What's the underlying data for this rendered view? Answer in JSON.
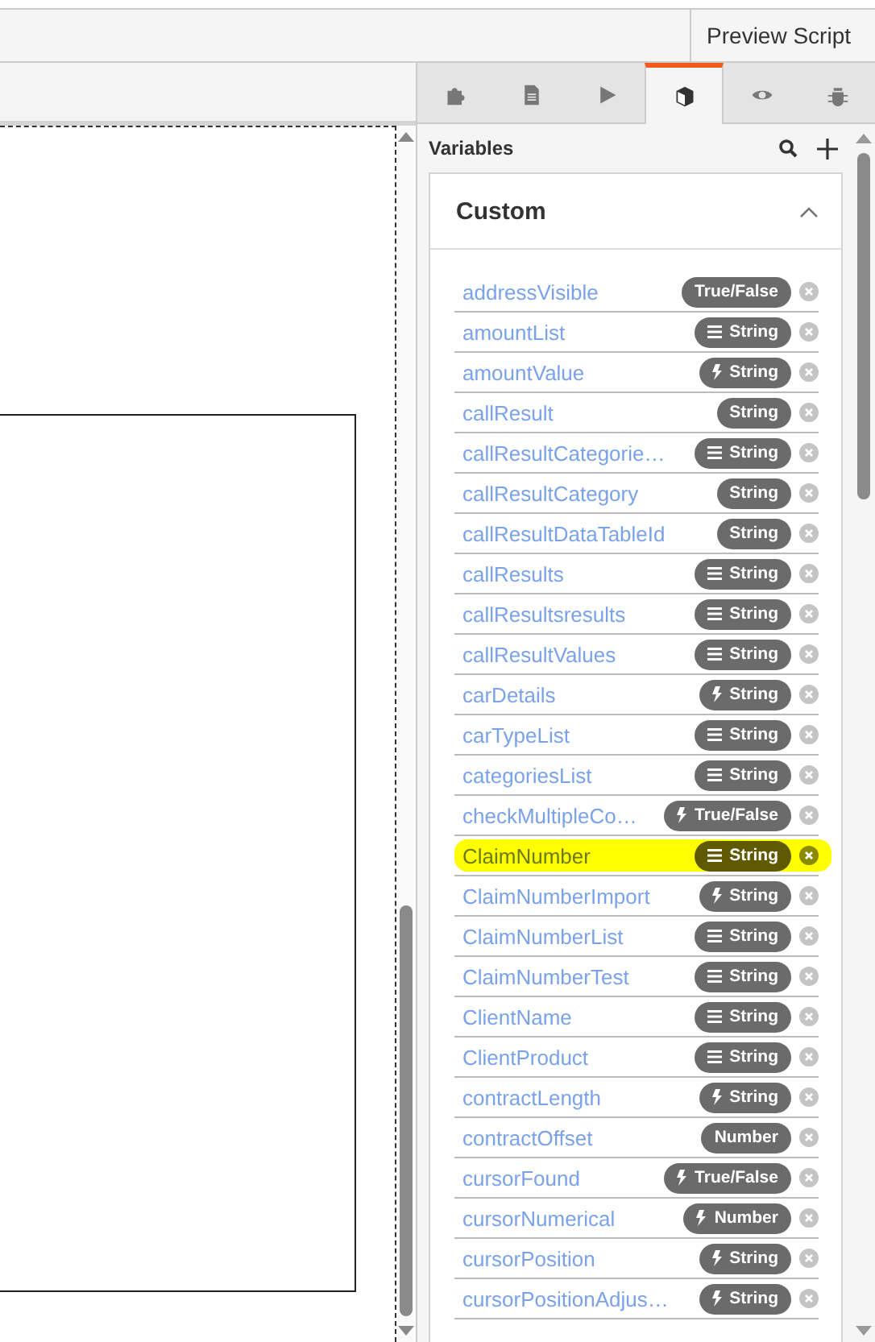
{
  "top_bar": {
    "preview_button": "Preview Script"
  },
  "tabs": [
    {
      "selected": false
    },
    {
      "selected": false
    },
    {
      "selected": false
    },
    {
      "selected": true
    },
    {
      "selected": false
    },
    {
      "selected": false
    }
  ],
  "variables_panel": {
    "title": "Variables",
    "section": {
      "title": "Custom",
      "expanded": true,
      "variables": [
        {
          "name": "addressVisible",
          "kind": "plain",
          "type": "True/False",
          "highlighted": false
        },
        {
          "name": "amountList",
          "kind": "list",
          "type": "String",
          "highlighted": false
        },
        {
          "name": "amountValue",
          "kind": "computed",
          "type": "String",
          "highlighted": false
        },
        {
          "name": "callResult",
          "kind": "plain",
          "type": "String",
          "highlighted": false
        },
        {
          "name": "callResultCategorie…",
          "kind": "list",
          "type": "String",
          "highlighted": false
        },
        {
          "name": "callResultCategory",
          "kind": "plain",
          "type": "String",
          "highlighted": false
        },
        {
          "name": "callResultDataTableId",
          "kind": "plain",
          "type": "String",
          "highlighted": false
        },
        {
          "name": "callResults",
          "kind": "list",
          "type": "String",
          "highlighted": false
        },
        {
          "name": "callResultsresults",
          "kind": "list",
          "type": "String",
          "highlighted": false
        },
        {
          "name": "callResultValues",
          "kind": "list",
          "type": "String",
          "highlighted": false
        },
        {
          "name": "carDetails",
          "kind": "computed",
          "type": "String",
          "highlighted": false
        },
        {
          "name": "carTypeList",
          "kind": "list",
          "type": "String",
          "highlighted": false
        },
        {
          "name": "categoriesList",
          "kind": "list",
          "type": "String",
          "highlighted": false
        },
        {
          "name": "checkMultipleCo…",
          "kind": "computed",
          "type": "True/False",
          "highlighted": false
        },
        {
          "name": "ClaimNumber",
          "kind": "list",
          "type": "String",
          "highlighted": true
        },
        {
          "name": "ClaimNumberImport",
          "kind": "computed",
          "type": "String",
          "highlighted": false
        },
        {
          "name": "ClaimNumberList",
          "kind": "list",
          "type": "String",
          "highlighted": false
        },
        {
          "name": "ClaimNumberTest",
          "kind": "list",
          "type": "String",
          "highlighted": false
        },
        {
          "name": "ClientName",
          "kind": "list",
          "type": "String",
          "highlighted": false
        },
        {
          "name": "ClientProduct",
          "kind": "list",
          "type": "String",
          "highlighted": false
        },
        {
          "name": "contractLength",
          "kind": "computed",
          "type": "String",
          "highlighted": false
        },
        {
          "name": "contractOffset",
          "kind": "plain",
          "type": "Number",
          "highlighted": false
        },
        {
          "name": "cursorFound",
          "kind": "computed",
          "type": "True/False",
          "highlighted": false
        },
        {
          "name": "cursorNumerical",
          "kind": "computed",
          "type": "Number",
          "highlighted": false
        },
        {
          "name": "cursorPosition",
          "kind": "computed",
          "type": "String",
          "highlighted": false
        },
        {
          "name": "cursorPositionAdjus…",
          "kind": "computed",
          "type": "String",
          "highlighted": false
        }
      ]
    }
  }
}
